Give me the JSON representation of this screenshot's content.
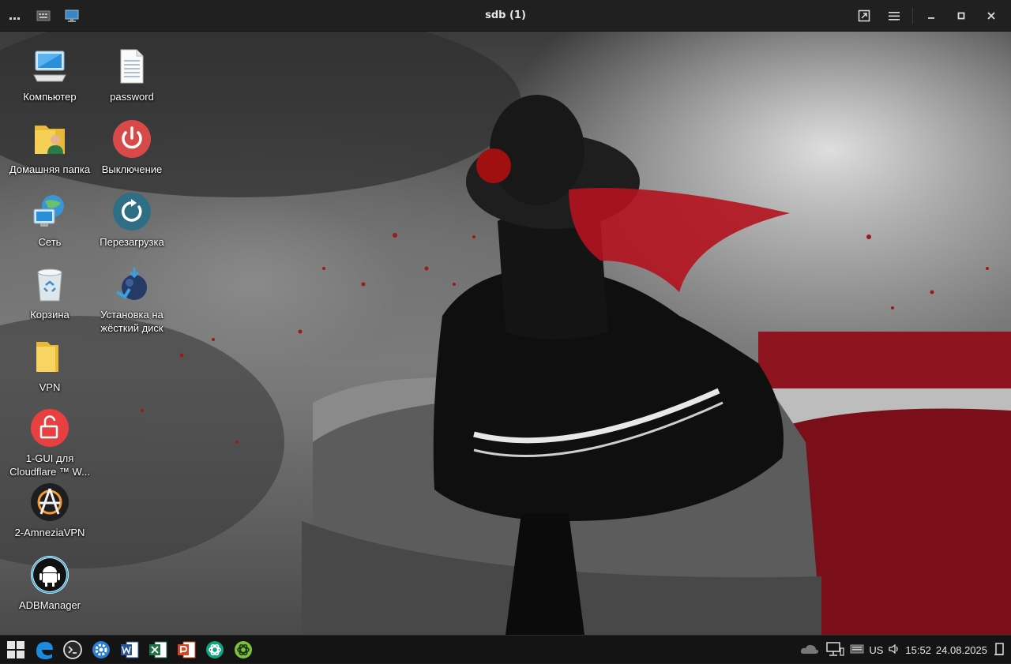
{
  "window": {
    "title": "sdb (1)"
  },
  "titlebar": {
    "left_icons": [
      "more-icon",
      "keyboard-icon",
      "monitor-icon"
    ],
    "right_buttons": [
      "fullscreen-icon",
      "menu-icon",
      "minimize-icon",
      "maximize-icon",
      "close-icon"
    ]
  },
  "desktop": {
    "icons": [
      {
        "label": "Компьютер",
        "icon": "computer-icon"
      },
      {
        "label": "password",
        "icon": "text-file-icon"
      },
      {
        "label": "Домашняя папка",
        "icon": "home-folder-icon"
      },
      {
        "label": "Выключение",
        "icon": "power-icon"
      },
      {
        "label": "Сеть",
        "icon": "network-icon"
      },
      {
        "label": "Перезагрузка",
        "icon": "reboot-icon"
      },
      {
        "label": "Корзина",
        "icon": "trash-icon"
      },
      {
        "label": "Установка на жёсткий диск",
        "icon": "install-icon"
      },
      {
        "label": "VPN",
        "icon": "folder-icon"
      },
      {
        "label": "1-GUI для Cloudflare ™ W...",
        "icon": "unlock-icon"
      },
      {
        "label": "2-AmneziaVPN",
        "icon": "amnezia-icon"
      },
      {
        "label": "ADBManager",
        "icon": "android-icon"
      }
    ]
  },
  "taskbar": {
    "apps": [
      "start-icon",
      "edge-icon",
      "terminal-icon",
      "settings-icon",
      "word-icon",
      "excel-icon",
      "powerpoint-icon",
      "chatgpt-icon",
      "chatgpt-green-icon"
    ],
    "tray": {
      "layout": "US",
      "time": "15:52",
      "date": "24.08.2025"
    }
  },
  "colors": {
    "accent_red": "#c0392b",
    "taskbar_bg": "#141414",
    "titlebar_bg": "#202020"
  }
}
